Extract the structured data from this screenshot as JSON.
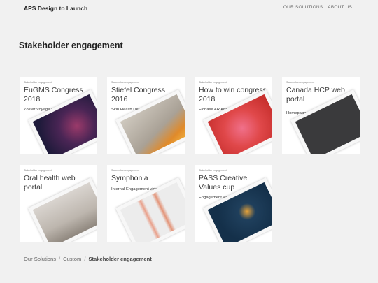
{
  "header": {
    "brand": "APS Design to Launch",
    "nav": [
      "OUR SOLUTIONS",
      "ABOUT US"
    ]
  },
  "section_title": "Stakeholder engagement",
  "cards": [
    {
      "tag": "Stakeholder engagement",
      "title": "EuGMS Congress 2018",
      "subtitle": "Zoster Voyage VR App"
    },
    {
      "tag": "Stakeholder engagement",
      "title": "Stiefel Congress 2016",
      "subtitle": "Skin Health Demo AR app"
    },
    {
      "tag": "Stakeholder engagement",
      "title": "How to win congress 2018",
      "subtitle": "Flonase AR App"
    },
    {
      "tag": "Stakeholder engagement",
      "title": "Canada HCP web portal",
      "subtitle": "Homepage animation"
    },
    {
      "tag": "Stakeholder engagement",
      "title": "Oral health web portal",
      "subtitle": ""
    },
    {
      "tag": "Stakeholder engagement",
      "title": "Symphonia",
      "subtitle": "Internal Engagement video"
    },
    {
      "tag": "Stakeholder engagement",
      "title": "PASS Creative Values cup",
      "subtitle": "Engagement video"
    }
  ],
  "breadcrumb": {
    "items": [
      "Our Solutions",
      "Custom"
    ],
    "separator": "/",
    "current": "Stakeholder engagement"
  }
}
